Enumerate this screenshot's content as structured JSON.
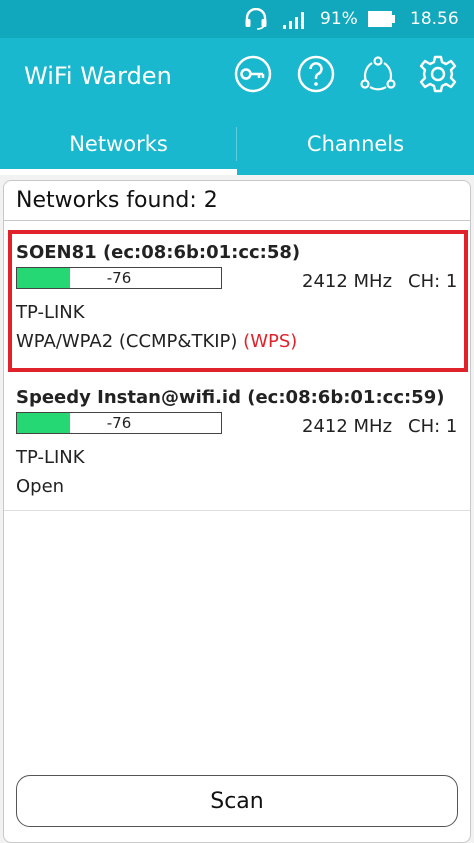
{
  "status_bar": {
    "headset_icon": "headset-icon",
    "signal_icon": "cell-signal-icon",
    "battery_percent": "91%",
    "battery_icon": "battery-icon",
    "time": "18.56"
  },
  "app_bar": {
    "title": "WiFi Warden",
    "icons": [
      "key-icon",
      "help-icon",
      "share-icon",
      "settings-icon"
    ]
  },
  "tabs": [
    {
      "label": "Networks",
      "selected": true
    },
    {
      "label": "Channels",
      "selected": false
    }
  ],
  "networks_found_label": "Networks found: 2",
  "networks": [
    {
      "ssid": "SOEN81 (ec:08:6b:01:cc:58)",
      "signal_dbm": "-76",
      "signal_fill_fraction": 0.26,
      "frequency": "2412 MHz",
      "channel": "CH: 1",
      "vendor": "TP-LINK",
      "security": "WPA/WPA2 (CCMP&TKIP)",
      "wps": "(WPS)",
      "highlighted": true
    },
    {
      "ssid": "Speedy Instan@wifi.id (ec:08:6b:01:cc:59)",
      "signal_dbm": "-76",
      "signal_fill_fraction": 0.26,
      "frequency": "2412 MHz",
      "channel": "CH: 1",
      "vendor": "TP-LINK",
      "security": "Open",
      "wps": "",
      "highlighted": false
    }
  ],
  "scan_button": "Scan",
  "colors": {
    "primary": "#19b8ce",
    "status_bar": "#11a7bc",
    "signal_fill": "#26d873",
    "highlight": "#e0222b"
  }
}
